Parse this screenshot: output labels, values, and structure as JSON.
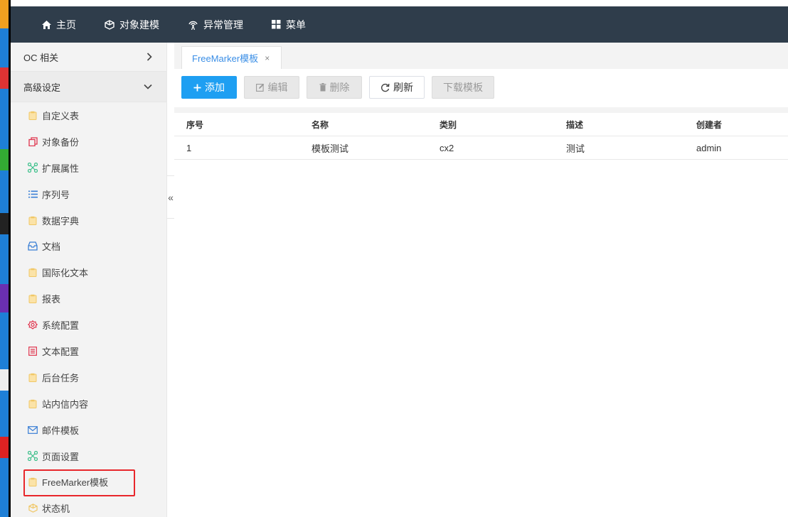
{
  "nav": {
    "items": [
      {
        "label": "主页",
        "icon": "home-icon"
      },
      {
        "label": "对象建模",
        "icon": "cube-icon"
      },
      {
        "label": "异常管理",
        "icon": "broadcast-icon"
      },
      {
        "label": "菜单",
        "icon": "grid-icon"
      }
    ]
  },
  "sidebar": {
    "groups": [
      {
        "label": "OC 相关",
        "state": "collapsed"
      },
      {
        "label": "高级设定",
        "state": "expanded"
      }
    ],
    "items": [
      {
        "label": "自定义表",
        "icon": "clipboard-icon"
      },
      {
        "label": "对象备份",
        "icon": "copy-icon"
      },
      {
        "label": "扩展属性",
        "icon": "network-icon"
      },
      {
        "label": "序列号",
        "icon": "list-icon"
      },
      {
        "label": "数据字典",
        "icon": "clipboard-icon"
      },
      {
        "label": "文档",
        "icon": "inbox-icon"
      },
      {
        "label": "国际化文本",
        "icon": "clipboard-icon"
      },
      {
        "label": "报表",
        "icon": "clipboard-icon"
      },
      {
        "label": "系统配置",
        "icon": "gear-icon"
      },
      {
        "label": "文本配置",
        "icon": "form-icon"
      },
      {
        "label": "后台任务",
        "icon": "clipboard-icon"
      },
      {
        "label": "站内信内容",
        "icon": "clipboard-icon"
      },
      {
        "label": "邮件模板",
        "icon": "mail-icon"
      },
      {
        "label": "页面设置",
        "icon": "network-icon"
      },
      {
        "label": "FreeMarker模板",
        "icon": "clipboard-icon",
        "selected": true
      },
      {
        "label": "状态机",
        "icon": "cube-icon"
      }
    ],
    "collapse_glyph": "«"
  },
  "tabs": [
    {
      "label": "FreeMarker模板",
      "close": "×"
    }
  ],
  "toolbar": {
    "add": "添加",
    "edit": "编辑",
    "delete": "删除",
    "refresh": "刷新",
    "download": "下载模板"
  },
  "table": {
    "columns": [
      "序号",
      "名称",
      "类别",
      "描述",
      "创建者"
    ],
    "rows": [
      [
        "1",
        "模板测试",
        "cx2",
        "测试",
        "admin"
      ]
    ]
  },
  "colors": {
    "topbar": "#2f3d4b",
    "primary": "#1e9ff2",
    "tab_text": "#3a8ee6",
    "highlight": "#e8262b"
  }
}
